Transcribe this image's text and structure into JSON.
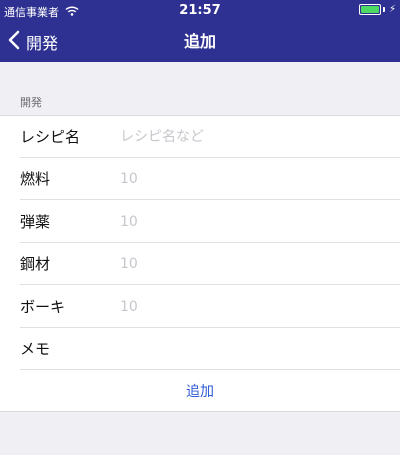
{
  "status_bar": {
    "carrier": "通信事業者",
    "time": "21:57",
    "wifi_icon": "wifi-icon",
    "battery_level": 1.0,
    "battery_color": "#4cd964"
  },
  "nav": {
    "back_label": "開発",
    "title": "追加",
    "bar_color": "#2e3192"
  },
  "section": {
    "header": "開発"
  },
  "form": {
    "rows": [
      {
        "label": "レシピ名",
        "value": "",
        "placeholder": "レシピ名など"
      },
      {
        "label": "燃料",
        "value": "",
        "placeholder": "10"
      },
      {
        "label": "弾薬",
        "value": "",
        "placeholder": "10"
      },
      {
        "label": "鋼材",
        "value": "",
        "placeholder": "10"
      },
      {
        "label": "ボーキ",
        "value": "",
        "placeholder": "10"
      },
      {
        "label": "メモ",
        "value": "",
        "placeholder": ""
      }
    ],
    "add_label": "追加",
    "add_color": "#2e5bd6"
  }
}
